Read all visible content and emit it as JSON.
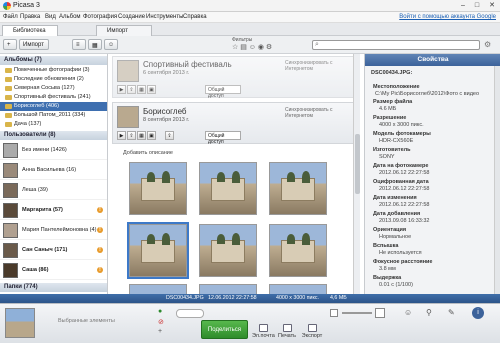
{
  "window": {
    "title": "Picasa 3",
    "minimize": "–",
    "maximize": "□",
    "close": "✕"
  },
  "menu": {
    "items": [
      "Файл",
      "Правка",
      "Вид",
      "Альбом",
      "Фотография",
      "Создание",
      "Инструменты",
      "Справка"
    ],
    "signin": "Войти с помощью аккаунта Google"
  },
  "tabs": [
    "Библиотека",
    "Импорт"
  ],
  "toolbar": {
    "import": "Импорт",
    "filters": "Фильтры"
  },
  "sidebar": {
    "albums_header": "Альбомы (7)",
    "albums": [
      "Помеченные фотографии (3)",
      "Последние обновления (2)",
      "Северная Сосьва (127)",
      "Спортивный фестиваль (241)",
      "Борисоглеб (406)",
      "Большой Патом_2011 (334)",
      "Дача (137)"
    ],
    "users_header": "Пользователи (8)",
    "people": [
      "Без имени (1426)",
      "Анна Васильева (16)",
      "Леша (39)",
      "Маргарита (57)",
      "Мария Пантелеймоновна (4)",
      "Сан Саныч (171)",
      "Саша (86)"
    ],
    "folders_header": "Папки (774)"
  },
  "center": {
    "album1": {
      "title": "Спортивный фестиваль",
      "date": "6 сентября 2013 г.",
      "sync": "Синхронизировать с Интернетом",
      "access": "Общий доступ"
    },
    "album2": {
      "title": "Борисоглеб",
      "date": "8 сентября 2013 г.",
      "sync": "Синхронизировать с Интернетом",
      "access": "Общий доступ",
      "add_desc": "Добавить описание"
    }
  },
  "properties": {
    "header": "Свойства",
    "filename": "DSC00434.JPG:",
    "fields": [
      {
        "label": "Местоположение",
        "value": "C:\\My Pic\\Борисоглеб\\2012\\Фото с видео"
      },
      {
        "label": "Размер файла",
        "value": "4.6 МБ"
      },
      {
        "label": "Разрешение",
        "value": "4000 x 3000 пикс."
      },
      {
        "label": "Модель фотокамеры",
        "value": "HDR-CX560E"
      },
      {
        "label": "Изготовитель",
        "value": "SONY"
      },
      {
        "label": "Дата на фотокамере",
        "value": "2012.06.12 22:27:58"
      },
      {
        "label": "Оцифрованная дата",
        "value": "2012.06.12 22:27:58"
      },
      {
        "label": "Дата изменения",
        "value": "2012.06.12 22:27:58"
      },
      {
        "label": "Дата добавления",
        "value": "2013.09.08 16:33:32"
      },
      {
        "label": "Ориентация",
        "value": "Нормальное"
      },
      {
        "label": "Вспышка",
        "value": "Не используется"
      },
      {
        "label": "Фокусное расстояние",
        "value": "3.8 мм"
      },
      {
        "label": "Выдержка",
        "value": "0.01 с (1/100)"
      }
    ]
  },
  "status": {
    "file": "DSC00434.JPG",
    "date": "12.06.2012 22:27:58",
    "res": "4000 x 3000 пикс.",
    "size": "4,6 МБ"
  },
  "tray": {
    "selected": "Выбранные элементы",
    "share": "Поделиться",
    "email": "Эл.почта",
    "print": "Печать",
    "export": "Экспорт"
  },
  "colors": {
    "accent": "#3e6fb0",
    "share": "#2f8c2b"
  }
}
